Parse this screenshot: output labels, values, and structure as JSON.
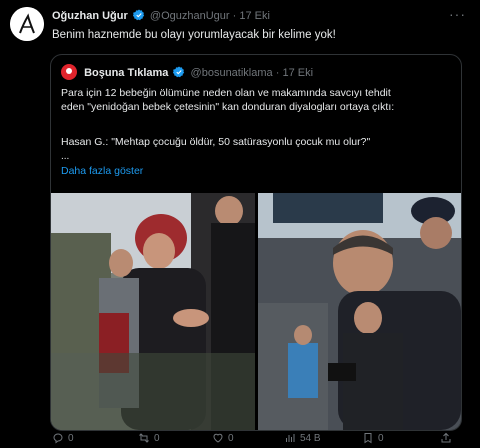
{
  "tweet": {
    "author_name": "Oğuzhan Uğur",
    "author_handle": "@OguzhanUgur",
    "separator": "·",
    "time": "17 Eki",
    "more": "···",
    "text": "Benim haznemde bu olayı yorumlayacak bir kelime yok!"
  },
  "quoted": {
    "author_name": "Boşuna Tıklama",
    "author_handle": "@bosunatiklama",
    "separator": "·",
    "time": "17 Eki",
    "line1": "Para için 12 bebeğin ölümüne neden olan ve makamında savcıyı tehdit",
    "line2": "eden \"yenidoğan bebek çetesinin\" kan donduran diyalogları ortaya çıktı:",
    "quote_text": "Hasan G.: \"Mehtap çocuğu öldür, 50 satürasyonlu çocuk mu olur?\"",
    "ellipsis": "...",
    "show_more": "Daha fazla göster"
  },
  "actions": {
    "replies": "0",
    "reposts": "0",
    "likes": "0",
    "views": "54 B",
    "bookmarks": "0"
  },
  "colors": {
    "background": "#000000",
    "text": "#e7e9ea",
    "secondary": "#71767b",
    "link": "#1d9bf0",
    "verified": "#1d9bf0",
    "quote_avatar": "#e0242c"
  },
  "icons": {
    "reply": "reply-icon",
    "repost": "repost-icon",
    "like": "like-icon",
    "views": "views-icon",
    "bookmark": "bookmark-icon",
    "share": "share-icon",
    "verified": "verified-badge-icon"
  }
}
